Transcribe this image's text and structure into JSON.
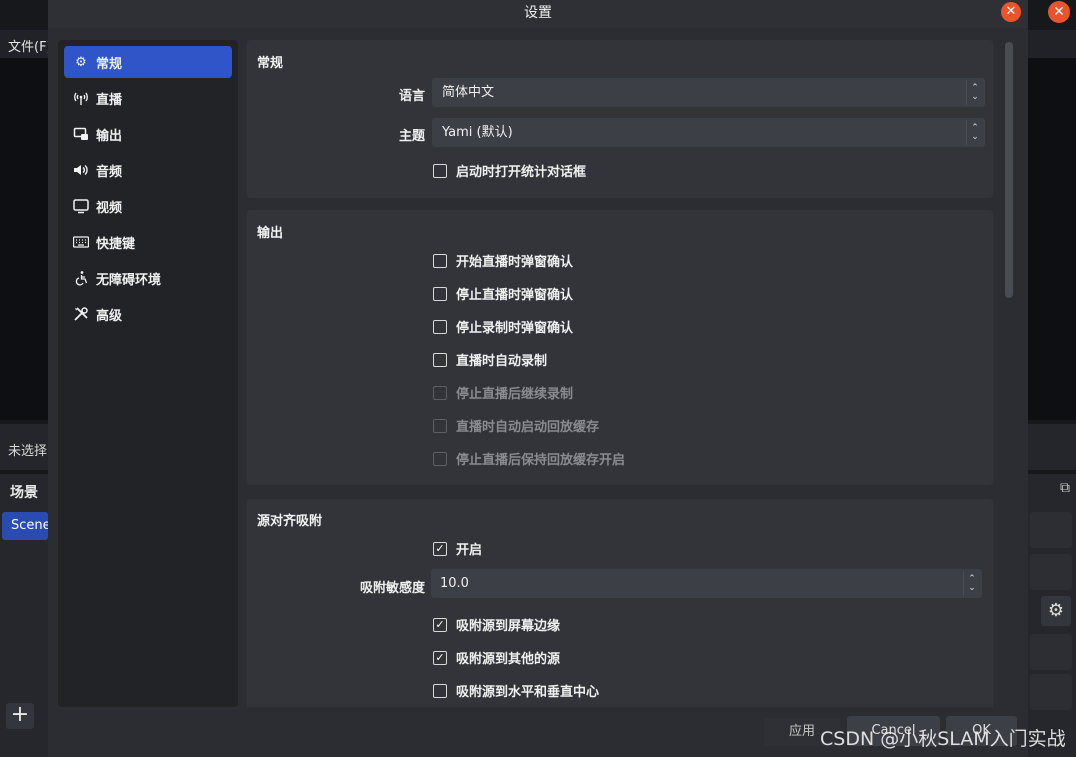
{
  "background": {
    "menu_label": "文件(F)",
    "status_text": "未选择",
    "scenes_title": "场景",
    "scene_item": "Scene",
    "add_label": "+"
  },
  "dialog": {
    "title": "设置",
    "close_glyph": "✕"
  },
  "sidebar": {
    "items": [
      {
        "label": "常规",
        "icon": "gear-icon",
        "glyph": "⚙"
      },
      {
        "label": "直播",
        "icon": "antenna-icon",
        "glyph": "📡"
      },
      {
        "label": "输出",
        "icon": "output-icon",
        "glyph": "▣"
      },
      {
        "label": "音频",
        "icon": "speaker-icon",
        "glyph": "🔊"
      },
      {
        "label": "视频",
        "icon": "monitor-icon",
        "glyph": "▭"
      },
      {
        "label": "快捷键",
        "icon": "keyboard-icon",
        "glyph": "⌨"
      },
      {
        "label": "无障碍环境",
        "icon": "accessibility-icon",
        "glyph": "♿"
      },
      {
        "label": "高级",
        "icon": "tools-icon",
        "glyph": "✂"
      }
    ],
    "active_index": 0
  },
  "general": {
    "title": "常规",
    "language_label": "语言",
    "language_value": "简体中文",
    "theme_label": "主题",
    "theme_value": "Yami (默认)",
    "open_stats_label": "启动时打开统计对话框",
    "open_stats_checked": false
  },
  "output": {
    "title": "输出",
    "items": [
      {
        "label": "开始直播时弹窗确认",
        "checked": false,
        "disabled": false
      },
      {
        "label": "停止直播时弹窗确认",
        "checked": false,
        "disabled": false
      },
      {
        "label": "停止录制时弹窗确认",
        "checked": false,
        "disabled": false
      },
      {
        "label": "直播时自动录制",
        "checked": false,
        "disabled": false
      },
      {
        "label": "停止直播后继续录制",
        "checked": false,
        "disabled": true
      },
      {
        "label": "直播时自动启动回放缓存",
        "checked": false,
        "disabled": true
      },
      {
        "label": "停止直播后保持回放缓存开启",
        "checked": false,
        "disabled": true
      }
    ]
  },
  "snapping": {
    "title": "源对齐吸附",
    "enable_label": "开启",
    "enable_checked": true,
    "sensitivity_label": "吸附敏感度",
    "sensitivity_value": "10.0",
    "items": [
      {
        "label": "吸附源到屏幕边缘",
        "checked": true
      },
      {
        "label": "吸附源到其他的源",
        "checked": true
      },
      {
        "label": "吸附源到水平和垂直中心",
        "checked": false
      }
    ]
  },
  "footer": {
    "apply": "应用",
    "cancel": "Cancel",
    "ok": "OK"
  },
  "watermark": "CSDN @小秋SLAM入门实战",
  "colors": {
    "accent": "#2f55c9",
    "close": "#e9542d"
  }
}
